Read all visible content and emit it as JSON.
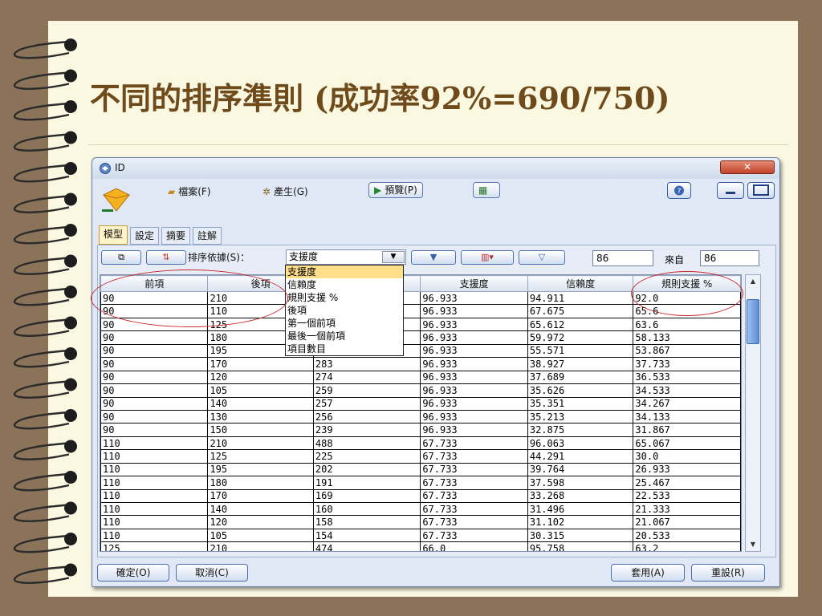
{
  "slide": {
    "title": "不同的排序準則 (成功率92%=690/750)"
  },
  "window": {
    "title": "ID",
    "close_label": "✕"
  },
  "toolbar": {
    "file_label": "檔案(F)",
    "generate_label": "產生(G)",
    "preview_label": "預覽(P)"
  },
  "tabs": [
    "模型",
    "設定",
    "摘要",
    "註解"
  ],
  "controls": {
    "sort_label": "排序依據(S)：",
    "sort_value": "支援度",
    "shown_count": "86",
    "from_label": "來自",
    "total_count": "86"
  },
  "sort_menu": [
    "支援度",
    "信賴度",
    "規則支援 %",
    "後項",
    "第一個前項",
    "最後一個前項",
    "項目數目"
  ],
  "table": {
    "columns": [
      "前項",
      "後項",
      "",
      "支援度",
      "信賴度",
      "規則支援 %"
    ],
    "rows": [
      [
        "90",
        "210",
        "",
        "96.933",
        "94.911",
        "92.0"
      ],
      [
        "90",
        "110",
        "",
        "96.933",
        "67.675",
        "65.6"
      ],
      [
        "90",
        "125",
        "",
        "96.933",
        "65.612",
        "63.6"
      ],
      [
        "90",
        "180",
        "",
        "96.933",
        "59.972",
        "58.133"
      ],
      [
        "90",
        "195",
        "",
        "96.933",
        "55.571",
        "53.867"
      ],
      [
        "90",
        "170",
        "283",
        "96.933",
        "38.927",
        "37.733"
      ],
      [
        "90",
        "120",
        "274",
        "96.933",
        "37.689",
        "36.533"
      ],
      [
        "90",
        "105",
        "259",
        "96.933",
        "35.626",
        "34.533"
      ],
      [
        "90",
        "140",
        "257",
        "96.933",
        "35.351",
        "34.267"
      ],
      [
        "90",
        "130",
        "256",
        "96.933",
        "35.213",
        "34.133"
      ],
      [
        "90",
        "150",
        "239",
        "96.933",
        "32.875",
        "31.867"
      ],
      [
        "110",
        "210",
        "488",
        "67.733",
        "96.063",
        "65.067"
      ],
      [
        "110",
        "125",
        "225",
        "67.733",
        "44.291",
        "30.0"
      ],
      [
        "110",
        "195",
        "202",
        "67.733",
        "39.764",
        "26.933"
      ],
      [
        "110",
        "180",
        "191",
        "67.733",
        "37.598",
        "25.467"
      ],
      [
        "110",
        "170",
        "169",
        "67.733",
        "33.268",
        "22.533"
      ],
      [
        "110",
        "140",
        "160",
        "67.733",
        "31.496",
        "21.333"
      ],
      [
        "110",
        "120",
        "158",
        "67.733",
        "31.102",
        "21.067"
      ],
      [
        "110",
        "105",
        "154",
        "67.733",
        "30.315",
        "20.533"
      ],
      [
        "125",
        "210",
        "474",
        "66.0",
        "95.758",
        "63.2"
      ]
    ]
  },
  "footer": {
    "ok_label": "確定(O)",
    "cancel_label": "取消(C)",
    "apply_label": "套用(A)",
    "reset_label": "重設(R)"
  }
}
